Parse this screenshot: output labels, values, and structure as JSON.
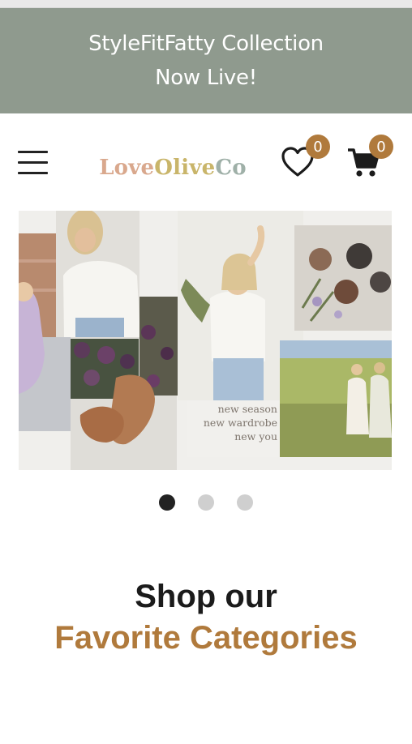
{
  "announcement": {
    "line1": "StyleFitFatty Collection",
    "line2": "Now Live!"
  },
  "header": {
    "logo": {
      "parts": [
        "Love ",
        "Olive ",
        "Co"
      ],
      "colors": [
        "#d9a88d",
        "#c9b56a",
        "#9fb0a8"
      ]
    },
    "wishlist_count": "0",
    "cart_count": "0"
  },
  "hero": {
    "caption": [
      "new season",
      "new wardrobe",
      "new you"
    ],
    "slides_total": 3,
    "active_slide": 1
  },
  "section": {
    "heading_line1": "Shop our",
    "heading_line2": "Favorite Categories"
  },
  "colors": {
    "announce_bg": "#8f9a8e",
    "accent": "#b07a3c",
    "text": "#1b1b1b"
  }
}
